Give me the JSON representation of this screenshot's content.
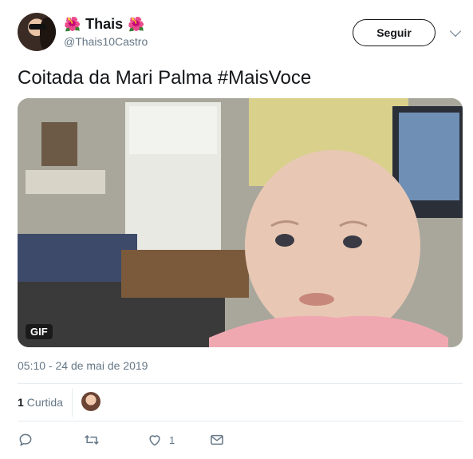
{
  "tweet": {
    "author": {
      "name": "Thais",
      "name_prefix_emoji": "🌺",
      "name_suffix_emoji": "🌺",
      "handle": "@Thais10Castro"
    },
    "follow_label": "Seguir",
    "text": "Coitada da Mari Palma #MaisVoce",
    "media": {
      "badge": "GIF"
    },
    "timestamp": "05:10 - 24 de mai de 2019",
    "stats": {
      "likes_count": "1",
      "likes_label": "Curtida"
    },
    "actions": {
      "like_count": "1"
    }
  },
  "icons": [
    "reply-icon",
    "retweet-icon",
    "like-icon",
    "message-icon",
    "chevron-down-icon"
  ],
  "colors": {
    "secondary_text": "#657786",
    "divider": "#e6ecf0",
    "primary_text": "#14171a"
  }
}
